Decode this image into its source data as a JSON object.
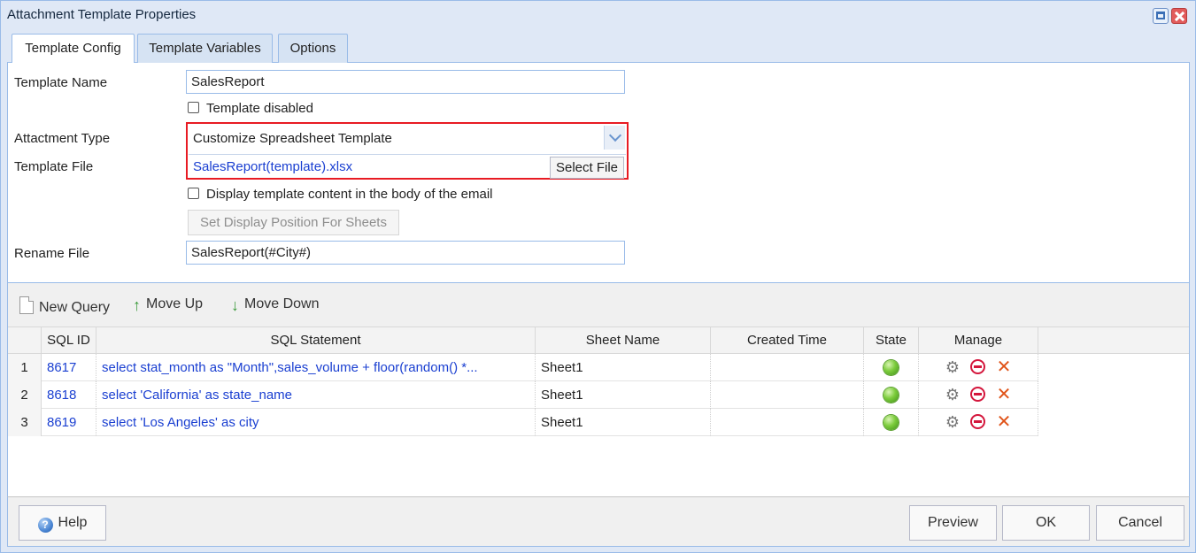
{
  "window": {
    "title": "Attachment Template Properties"
  },
  "tabs": [
    {
      "label": "Template Config",
      "active": true
    },
    {
      "label": "Template Variables",
      "active": false
    },
    {
      "label": "Options",
      "active": false
    }
  ],
  "form": {
    "template_name_label": "Template Name",
    "template_name_value": "SalesReport",
    "template_disabled_label": "Template disabled",
    "template_disabled_checked": false,
    "attachment_type_label": "Attactment Type",
    "attachment_type_value": "Customize Spreadsheet Template",
    "template_file_label": "Template File",
    "template_file_value": "SalesReport(template).xlsx",
    "select_file_label": "Select File",
    "display_in_body_label": "Display template content in the body of the email",
    "display_in_body_checked": false,
    "set_display_position_label": "Set Display Position For Sheets",
    "rename_file_label": "Rename File",
    "rename_file_value": "SalesReport(#City#)"
  },
  "toolbar": {
    "new_query": "New Query",
    "move_up": "Move Up",
    "move_down": "Move Down"
  },
  "grid": {
    "columns": [
      "SQL ID",
      "SQL Statement",
      "Sheet Name",
      "Created Time",
      "State",
      "Manage"
    ],
    "rows": [
      {
        "num": "1",
        "sql_id": "8617",
        "sql": "select stat_month as \"Month\",sales_volume + floor(random() *...",
        "sheet": "Sheet1",
        "created": "",
        "state": "active"
      },
      {
        "num": "2",
        "sql_id": "8618",
        "sql": "select 'California' as state_name",
        "sheet": "Sheet1",
        "created": "",
        "state": "active"
      },
      {
        "num": "3",
        "sql_id": "8619",
        "sql": "select 'Los Angeles' as city",
        "sheet": "Sheet1",
        "created": "",
        "state": "active"
      }
    ]
  },
  "footer": {
    "help": "Help",
    "preview": "Preview",
    "ok": "OK",
    "cancel": "Cancel"
  },
  "colors": {
    "link": "#1a3fd1",
    "highlight_border": "#e81b23",
    "panel_border": "#99bbe8",
    "state_active": "#7ccc3c"
  },
  "icons": {
    "new_query": "document-icon",
    "move_up": "arrow-up-icon",
    "move_down": "arrow-down-icon",
    "help": "help-icon",
    "manage": [
      "gear-icon",
      "remove-icon",
      "delete-icon"
    ]
  }
}
